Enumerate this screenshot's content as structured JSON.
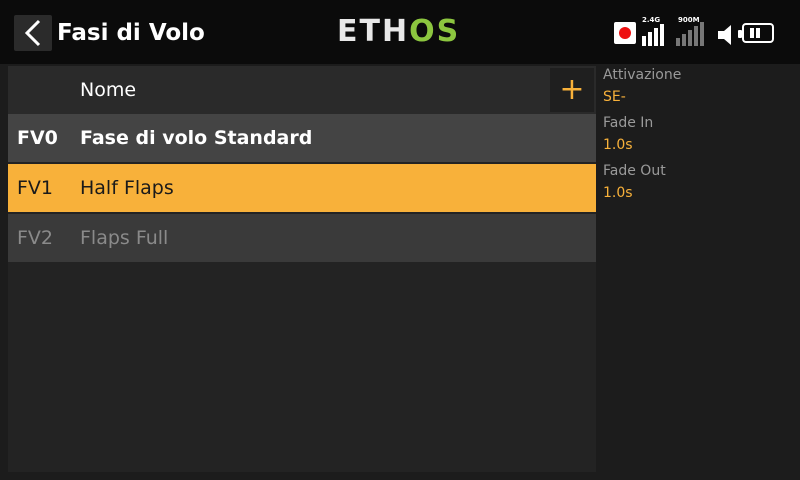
{
  "header": {
    "title": "Fasi di Volo",
    "logo_left": "ETH",
    "logo_right": "OS",
    "signal_labels": [
      "2.4G",
      "900M"
    ]
  },
  "table": {
    "header_name": "Nome",
    "add_label": "+",
    "rows": [
      {
        "id": "FV0",
        "name": "Fase di volo Standard",
        "state": "normal"
      },
      {
        "id": "FV1",
        "name": "Half Flaps",
        "state": "selected"
      },
      {
        "id": "FV2",
        "name": "Flaps Full",
        "state": "disabled"
      }
    ]
  },
  "details": {
    "activation_label": "Attivazione",
    "activation_value": "SE-",
    "fade_in_label": "Fade In",
    "fade_in_value": "1.0s",
    "fade_out_label": "Fade Out",
    "fade_out_value": "1.0s"
  },
  "colors": {
    "accent": "#f8b13a",
    "logo_green": "#8cc63f",
    "record_red": "#e11111"
  }
}
